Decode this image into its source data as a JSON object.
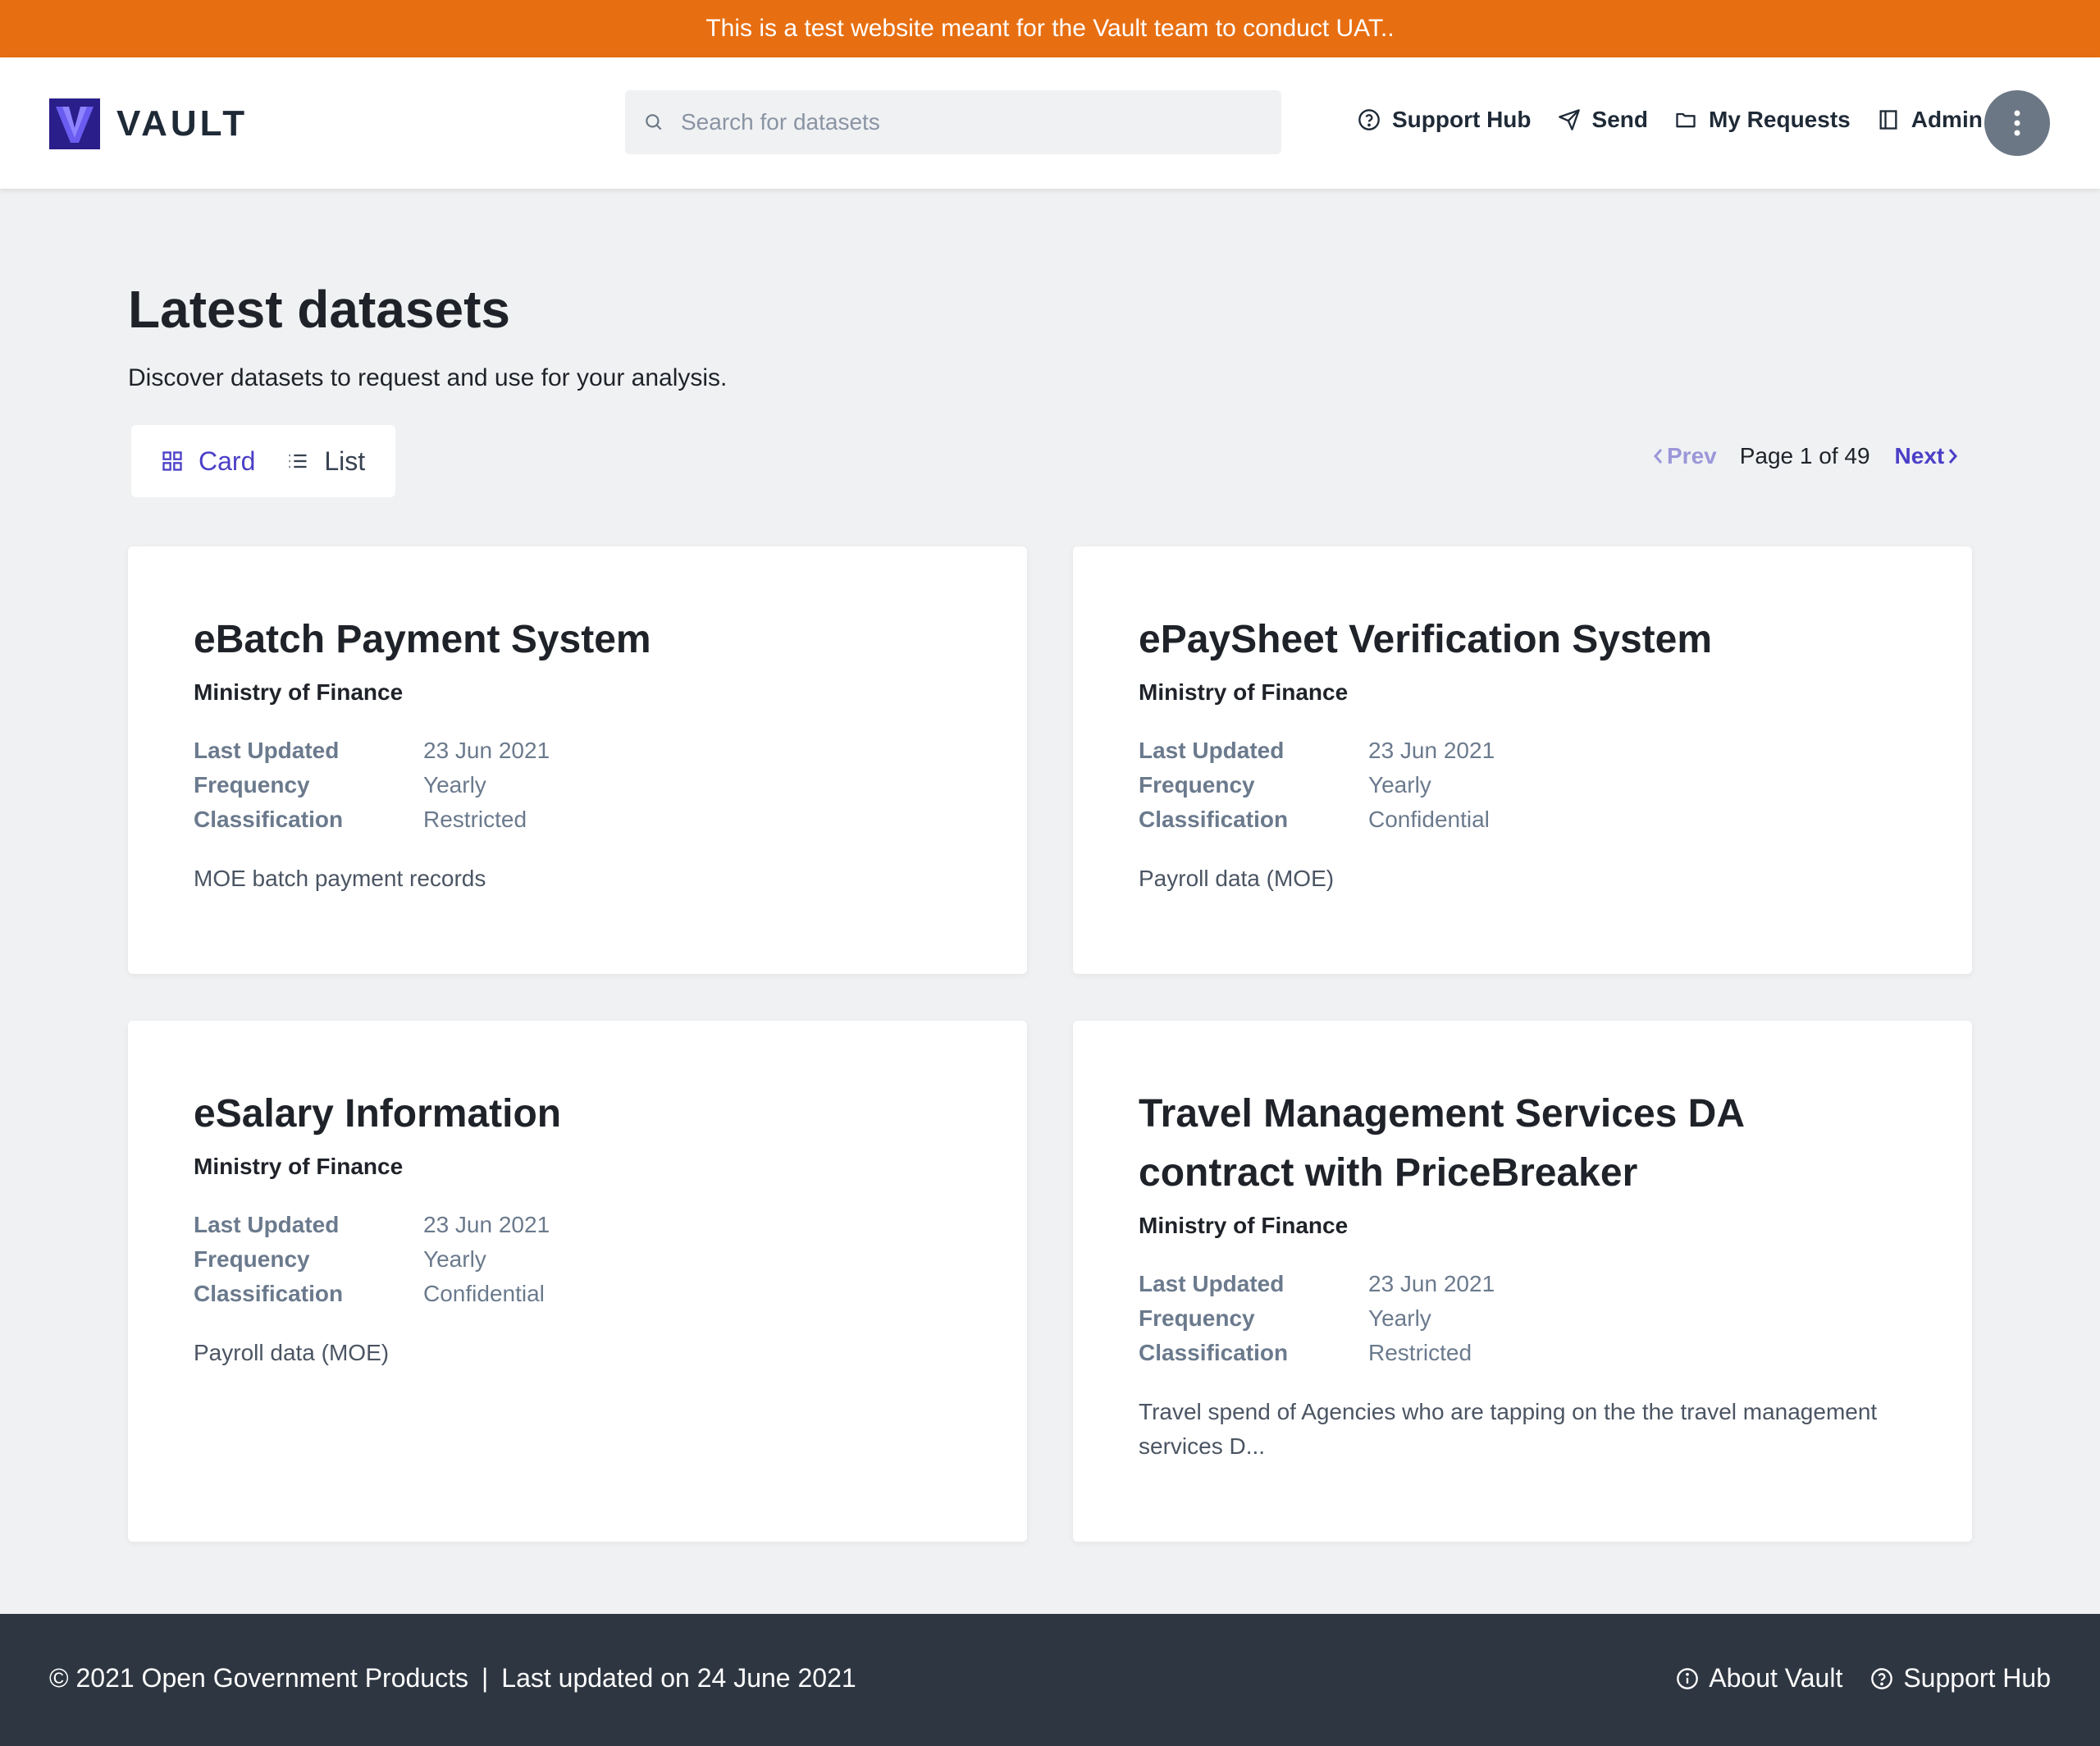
{
  "banner": {
    "text": "This is a test website meant for the Vault team to conduct UAT.."
  },
  "header": {
    "logo_text": "VAULT",
    "search": {
      "placeholder": "Search for datasets",
      "value": ""
    },
    "nav": [
      {
        "label": "Support Hub",
        "icon": "help-circle-icon"
      },
      {
        "label": "Send",
        "icon": "send-icon"
      },
      {
        "label": "My Requests",
        "icon": "folder-icon"
      },
      {
        "label": "Admin",
        "icon": "sidebar-panel-icon"
      }
    ],
    "menu_icon": "more-vertical-icon"
  },
  "main": {
    "title": "Latest datasets",
    "subtitle": "Discover datasets to request and use for your analysis.",
    "view_toggle": {
      "card_label": "Card",
      "list_label": "List",
      "active": "Card"
    },
    "pagination": {
      "prev_label": "Prev",
      "page_info": "Page 1 of 49",
      "next_label": "Next"
    },
    "meta_labels": {
      "last_updated": "Last Updated",
      "frequency": "Frequency",
      "classification": "Classification"
    },
    "datasets": [
      {
        "title": "eBatch Payment System",
        "agency": "Ministry of Finance",
        "last_updated": "23 Jun 2021",
        "frequency": "Yearly",
        "classification": "Restricted",
        "description": "MOE batch payment records"
      },
      {
        "title": "ePaySheet Verification System",
        "agency": "Ministry of Finance",
        "last_updated": "23 Jun 2021",
        "frequency": "Yearly",
        "classification": "Confidential",
        "description": "Payroll data (MOE)"
      },
      {
        "title": "eSalary Information",
        "agency": "Ministry of Finance",
        "last_updated": "23 Jun 2021",
        "frequency": "Yearly",
        "classification": "Confidential",
        "description": "Payroll data (MOE)"
      },
      {
        "title": "Travel Management Services DA contract with PriceBreaker",
        "agency": "Ministry of Finance",
        "last_updated": "23 Jun 2021",
        "frequency": "Yearly",
        "classification": "Restricted",
        "description": "Travel spend of Agencies who are tapping on the the travel management services D..."
      }
    ]
  },
  "footer": {
    "copyright": "© 2021 Open Government Products",
    "separator": "|",
    "last_updated": "Last updated on 24 June 2021",
    "links": [
      {
        "label": "About Vault",
        "icon": "info-icon"
      },
      {
        "label": "Support Hub",
        "icon": "help-circle-icon"
      }
    ]
  },
  "colors": {
    "banner": "#e76f12",
    "accent": "#4b3fc7",
    "footer": "#2e3641",
    "page_bg": "#f0f1f3"
  }
}
